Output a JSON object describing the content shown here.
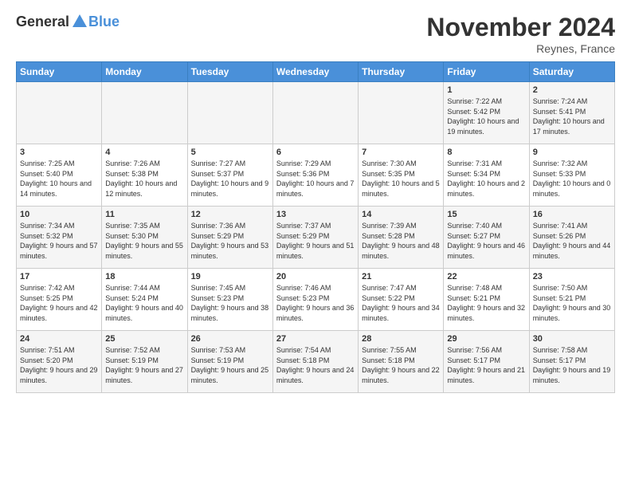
{
  "logo": {
    "general": "General",
    "blue": "Blue"
  },
  "title": "November 2024",
  "location": "Reynes, France",
  "days_header": [
    "Sunday",
    "Monday",
    "Tuesday",
    "Wednesday",
    "Thursday",
    "Friday",
    "Saturday"
  ],
  "rows": [
    [
      {
        "day": "",
        "info": ""
      },
      {
        "day": "",
        "info": ""
      },
      {
        "day": "",
        "info": ""
      },
      {
        "day": "",
        "info": ""
      },
      {
        "day": "",
        "info": ""
      },
      {
        "day": "1",
        "info": "Sunrise: 7:22 AM\nSunset: 5:42 PM\nDaylight: 10 hours and 19 minutes."
      },
      {
        "day": "2",
        "info": "Sunrise: 7:24 AM\nSunset: 5:41 PM\nDaylight: 10 hours and 17 minutes."
      }
    ],
    [
      {
        "day": "3",
        "info": "Sunrise: 7:25 AM\nSunset: 5:40 PM\nDaylight: 10 hours and 14 minutes."
      },
      {
        "day": "4",
        "info": "Sunrise: 7:26 AM\nSunset: 5:38 PM\nDaylight: 10 hours and 12 minutes."
      },
      {
        "day": "5",
        "info": "Sunrise: 7:27 AM\nSunset: 5:37 PM\nDaylight: 10 hours and 9 minutes."
      },
      {
        "day": "6",
        "info": "Sunrise: 7:29 AM\nSunset: 5:36 PM\nDaylight: 10 hours and 7 minutes."
      },
      {
        "day": "7",
        "info": "Sunrise: 7:30 AM\nSunset: 5:35 PM\nDaylight: 10 hours and 5 minutes."
      },
      {
        "day": "8",
        "info": "Sunrise: 7:31 AM\nSunset: 5:34 PM\nDaylight: 10 hours and 2 minutes."
      },
      {
        "day": "9",
        "info": "Sunrise: 7:32 AM\nSunset: 5:33 PM\nDaylight: 10 hours and 0 minutes."
      }
    ],
    [
      {
        "day": "10",
        "info": "Sunrise: 7:34 AM\nSunset: 5:32 PM\nDaylight: 9 hours and 57 minutes."
      },
      {
        "day": "11",
        "info": "Sunrise: 7:35 AM\nSunset: 5:30 PM\nDaylight: 9 hours and 55 minutes."
      },
      {
        "day": "12",
        "info": "Sunrise: 7:36 AM\nSunset: 5:29 PM\nDaylight: 9 hours and 53 minutes."
      },
      {
        "day": "13",
        "info": "Sunrise: 7:37 AM\nSunset: 5:29 PM\nDaylight: 9 hours and 51 minutes."
      },
      {
        "day": "14",
        "info": "Sunrise: 7:39 AM\nSunset: 5:28 PM\nDaylight: 9 hours and 48 minutes."
      },
      {
        "day": "15",
        "info": "Sunrise: 7:40 AM\nSunset: 5:27 PM\nDaylight: 9 hours and 46 minutes."
      },
      {
        "day": "16",
        "info": "Sunrise: 7:41 AM\nSunset: 5:26 PM\nDaylight: 9 hours and 44 minutes."
      }
    ],
    [
      {
        "day": "17",
        "info": "Sunrise: 7:42 AM\nSunset: 5:25 PM\nDaylight: 9 hours and 42 minutes."
      },
      {
        "day": "18",
        "info": "Sunrise: 7:44 AM\nSunset: 5:24 PM\nDaylight: 9 hours and 40 minutes."
      },
      {
        "day": "19",
        "info": "Sunrise: 7:45 AM\nSunset: 5:23 PM\nDaylight: 9 hours and 38 minutes."
      },
      {
        "day": "20",
        "info": "Sunrise: 7:46 AM\nSunset: 5:23 PM\nDaylight: 9 hours and 36 minutes."
      },
      {
        "day": "21",
        "info": "Sunrise: 7:47 AM\nSunset: 5:22 PM\nDaylight: 9 hours and 34 minutes."
      },
      {
        "day": "22",
        "info": "Sunrise: 7:48 AM\nSunset: 5:21 PM\nDaylight: 9 hours and 32 minutes."
      },
      {
        "day": "23",
        "info": "Sunrise: 7:50 AM\nSunset: 5:21 PM\nDaylight: 9 hours and 30 minutes."
      }
    ],
    [
      {
        "day": "24",
        "info": "Sunrise: 7:51 AM\nSunset: 5:20 PM\nDaylight: 9 hours and 29 minutes."
      },
      {
        "day": "25",
        "info": "Sunrise: 7:52 AM\nSunset: 5:19 PM\nDaylight: 9 hours and 27 minutes."
      },
      {
        "day": "26",
        "info": "Sunrise: 7:53 AM\nSunset: 5:19 PM\nDaylight: 9 hours and 25 minutes."
      },
      {
        "day": "27",
        "info": "Sunrise: 7:54 AM\nSunset: 5:18 PM\nDaylight: 9 hours and 24 minutes."
      },
      {
        "day": "28",
        "info": "Sunrise: 7:55 AM\nSunset: 5:18 PM\nDaylight: 9 hours and 22 minutes."
      },
      {
        "day": "29",
        "info": "Sunrise: 7:56 AM\nSunset: 5:17 PM\nDaylight: 9 hours and 21 minutes."
      },
      {
        "day": "30",
        "info": "Sunrise: 7:58 AM\nSunset: 5:17 PM\nDaylight: 9 hours and 19 minutes."
      }
    ]
  ]
}
